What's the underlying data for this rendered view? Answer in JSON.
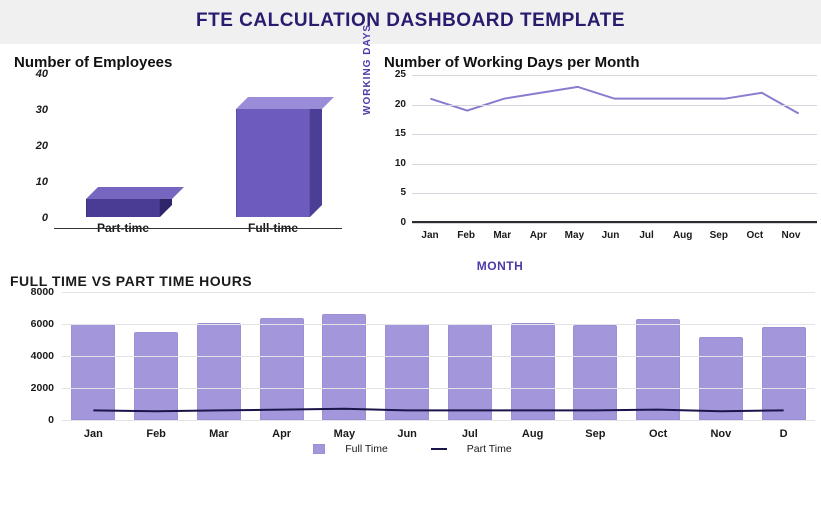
{
  "header": {
    "title": "FTE CALCULATION DASHBOARD TEMPLATE"
  },
  "employees": {
    "title": "Number of Employees",
    "cats": [
      "Part-time",
      "Full-time"
    ],
    "vals": [
      5,
      30
    ],
    "yticks": [
      0,
      10,
      20,
      30,
      40
    ]
  },
  "workdays": {
    "title": "Number of Working Days per Month",
    "ylabel": "WORKING DAYS",
    "xlabel": "MONTH",
    "yticks": [
      0,
      5,
      10,
      15,
      20,
      25
    ],
    "cats": [
      "Jan",
      "Feb",
      "Mar",
      "Apr",
      "May",
      "Jun",
      "Jul",
      "Aug",
      "Sep",
      "Oct",
      "Nov"
    ],
    "vals": [
      21,
      19,
      21,
      22,
      23,
      21,
      21,
      21,
      21,
      22,
      18.5
    ]
  },
  "hours": {
    "title": "FULL TIME VS PART TIME HOURS",
    "yticks": [
      0,
      2000,
      4000,
      6000,
      8000
    ],
    "cats": [
      "Jan",
      "Feb",
      "Mar",
      "Apr",
      "May",
      "Jun",
      "Jul",
      "Aug",
      "Sep",
      "Oct",
      "Nov",
      "D"
    ],
    "full": [
      6000,
      5500,
      6050,
      6350,
      6650,
      6000,
      6000,
      6050,
      5950,
      6300,
      5200,
      5800
    ],
    "part": [
      600,
      550,
      600,
      650,
      700,
      600,
      600,
      600,
      600,
      650,
      550,
      600
    ],
    "legend": {
      "full": "Full Time",
      "part": "Part Time"
    }
  },
  "chart_data": [
    {
      "type": "bar",
      "title": "Number of Employees",
      "categories": [
        "Part-time",
        "Full-time"
      ],
      "values": [
        5,
        30
      ],
      "ylim": [
        0,
        40
      ]
    },
    {
      "type": "line",
      "title": "Number of Working Days per Month",
      "xlabel": "MONTH",
      "ylabel": "WORKING DAYS",
      "categories": [
        "Jan",
        "Feb",
        "Mar",
        "Apr",
        "May",
        "Jun",
        "Jul",
        "Aug",
        "Sep",
        "Oct",
        "Nov"
      ],
      "values": [
        21,
        19,
        21,
        22,
        23,
        21,
        21,
        21,
        21,
        22,
        18.5
      ],
      "ylim": [
        0,
        25
      ]
    },
    {
      "type": "bar",
      "title": "FULL TIME VS PART TIME HOURS",
      "categories": [
        "Jan",
        "Feb",
        "Mar",
        "Apr",
        "May",
        "Jun",
        "Jul",
        "Aug",
        "Sep",
        "Oct",
        "Nov",
        "Dec"
      ],
      "series": [
        {
          "name": "Full Time",
          "values": [
            6000,
            5500,
            6050,
            6350,
            6650,
            6000,
            6000,
            6050,
            5950,
            6300,
            5200,
            5800
          ]
        },
        {
          "name": "Part Time",
          "values": [
            600,
            550,
            600,
            650,
            700,
            600,
            600,
            600,
            600,
            650,
            550,
            600
          ],
          "type": "line"
        }
      ],
      "ylim": [
        0,
        8000
      ]
    }
  ]
}
